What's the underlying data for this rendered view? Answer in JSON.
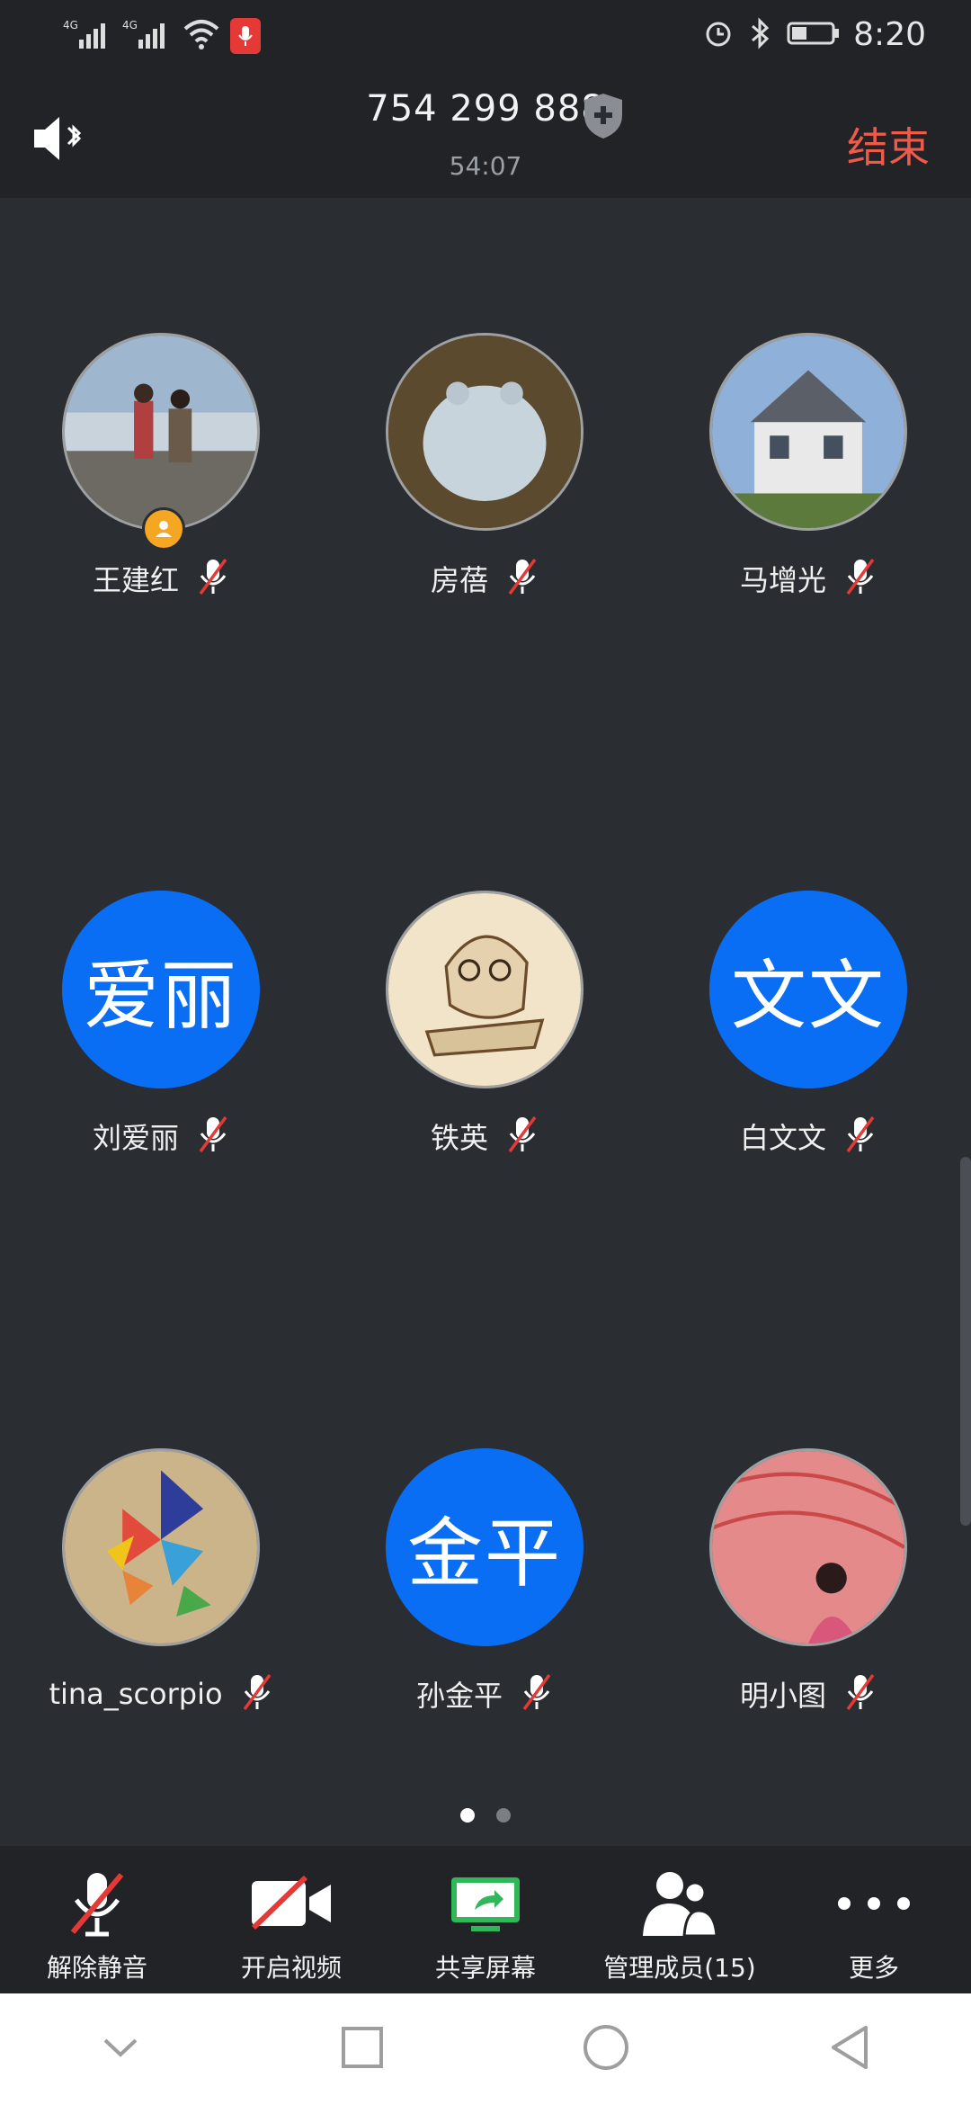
{
  "status_bar": {
    "network_1": "4G",
    "network_2": "4G",
    "time": "8:20"
  },
  "header": {
    "meeting_id": "754 299 888",
    "duration": "54:07",
    "end_label": "结束"
  },
  "participants": [
    {
      "name": "王建红",
      "avatar_type": "photo",
      "host": true
    },
    {
      "name": "房蓓",
      "avatar_type": "photo"
    },
    {
      "name": "马增光",
      "avatar_type": "photo"
    },
    {
      "name": "刘爱丽",
      "avatar_type": "text",
      "avatar_text": "爱丽"
    },
    {
      "name": "铁英",
      "avatar_type": "photo"
    },
    {
      "name": "白文文",
      "avatar_type": "text",
      "avatar_text": "文文"
    },
    {
      "name": "tina_scorpio",
      "avatar_type": "photo"
    },
    {
      "name": "孙金平",
      "avatar_type": "text",
      "avatar_text": "金平"
    },
    {
      "name": "明小图",
      "avatar_type": "photo"
    }
  ],
  "pager": {
    "pages": 2,
    "current": 1
  },
  "toolbar": {
    "unmute_label": "解除静音",
    "video_label": "开启视频",
    "share_label": "共享屏幕",
    "members_label": "管理成员(15)",
    "more_label": "更多"
  },
  "colors": {
    "background": "#2a2d31",
    "bar": "#212327",
    "accent_blue": "#0a6ef5",
    "end_red": "#ef5a4a",
    "share_green": "#2fb75a",
    "host_badge": "#f5a623"
  }
}
